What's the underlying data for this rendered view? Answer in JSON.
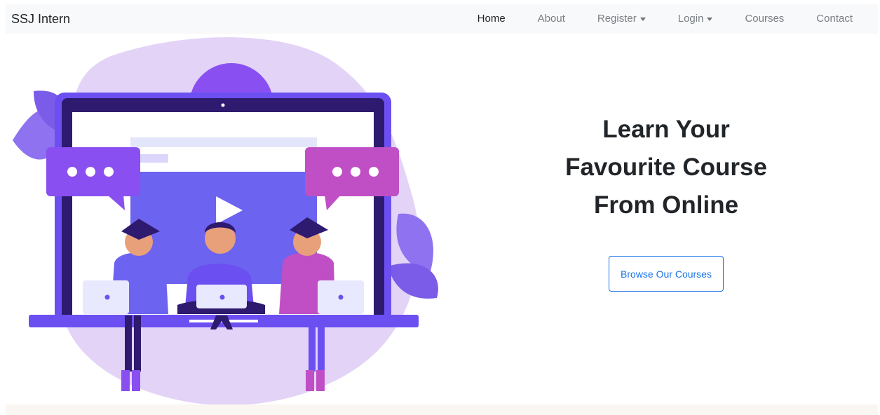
{
  "brand": "SSJ Intern",
  "nav": {
    "home": "Home",
    "about": "About",
    "register": "Register",
    "login": "Login",
    "courses": "Courses",
    "contact": "Contact"
  },
  "hero": {
    "line1": "Learn Your",
    "line2": "Favourite Course",
    "line3": "From Online",
    "cta": "Browse Our Courses"
  },
  "colors": {
    "accent": "#1a73e8",
    "navbar_bg": "#f8f9fa",
    "illustration_primary": "#6c4ff0",
    "illustration_pink": "#c04fc6"
  },
  "icons": {
    "dropdown": "caret-down-icon",
    "video": "play-icon"
  }
}
